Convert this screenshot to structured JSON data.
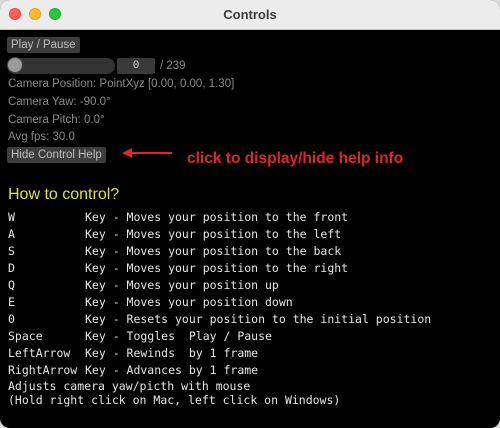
{
  "window": {
    "title": "Controls"
  },
  "controls": {
    "play_pause_label": "Play / Pause",
    "frame_value": "0",
    "frame_total": "/ 239",
    "slider_progress": 0,
    "camera_position": "Camera Position: PointXyz [0.00, 0.00, 1.30]",
    "camera_yaw": "Camera Yaw: -90.0°",
    "camera_pitch": "Camera Pitch: 0.0°",
    "avg_fps": "Avg fps: 30.0",
    "hide_help_label": "Hide Control Help"
  },
  "annotation": {
    "text": "click to display/hide help info",
    "color": "#e0262a"
  },
  "help": {
    "title": "How to control?",
    "keys": [
      {
        "key": "W",
        "desc": "Key - Moves your position to the front"
      },
      {
        "key": "A",
        "desc": "Key - Moves your position to the left"
      },
      {
        "key": "S",
        "desc": "Key - Moves your position to the back"
      },
      {
        "key": "D",
        "desc": "Key - Moves your position to the right"
      },
      {
        "key": "Q",
        "desc": "Key - Moves your position up"
      },
      {
        "key": "E",
        "desc": "Key - Moves your position down"
      },
      {
        "key": "0",
        "desc": "Key - Resets your position to the initial position"
      },
      {
        "key": "Space",
        "desc": "Key - Toggles  Play / Pause"
      },
      {
        "key": "LeftArrow",
        "desc": "Key - Rewinds  by 1 frame"
      },
      {
        "key": "RightArrow",
        "desc": "Key - Advances by 1 frame"
      }
    ],
    "mouse_line1": "Adjusts camera yaw/picth with mouse",
    "mouse_line2": "(Hold right click on Mac, left click on Windows)"
  },
  "colors": {
    "title_text": "#e4e41f",
    "annotation": "#e0262a",
    "background": "#000000"
  }
}
